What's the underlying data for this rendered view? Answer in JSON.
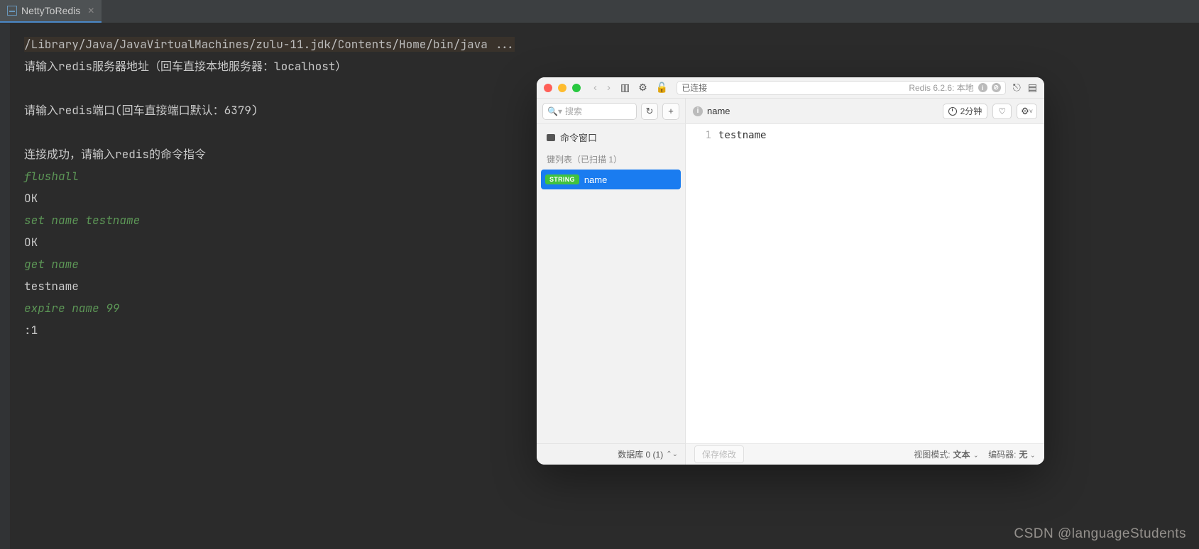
{
  "tab": {
    "title": "NettyToRedis"
  },
  "console": {
    "path": "/Library/Java/JavaVirtualMachines/zulu-11.jdk/Contents/Home/bin/java ...",
    "l1": "请输入redis服务器地址（回车直接本地服务器：localhost）",
    "l2": "",
    "l3": "请输入redis端口(回车直接端口默认：6379)",
    "l4": "",
    "l5": "连接成功，请输入redis的命令指令",
    "c1": "flushall",
    "r1": "OK",
    "c2": "set name testname",
    "r2": "OK",
    "c3": "get name",
    "r3": "testname",
    "c4": "expire name 99",
    "r4": ":1"
  },
  "rdm": {
    "titlebar": {
      "status": "已连接",
      "server": "Redis 6.2.6: 本地"
    },
    "toolbar": {
      "search_placeholder": "搜索",
      "key_name": "name",
      "ttl_badge": "2分钟"
    },
    "sidebar": {
      "cmdwin": "命令窗口",
      "section": "键列表（已扫描 1）",
      "key_type": "STRING",
      "key_label": "name",
      "db_label": "数据库 0 (1)"
    },
    "main": {
      "line_no": "1",
      "value": "testname",
      "save_label": "保存修改",
      "view_mode_label": "视图模式:",
      "view_mode_value": "文本",
      "encoder_label": "编码器:",
      "encoder_value": "无"
    }
  },
  "watermark": "CSDN @languageStudents"
}
